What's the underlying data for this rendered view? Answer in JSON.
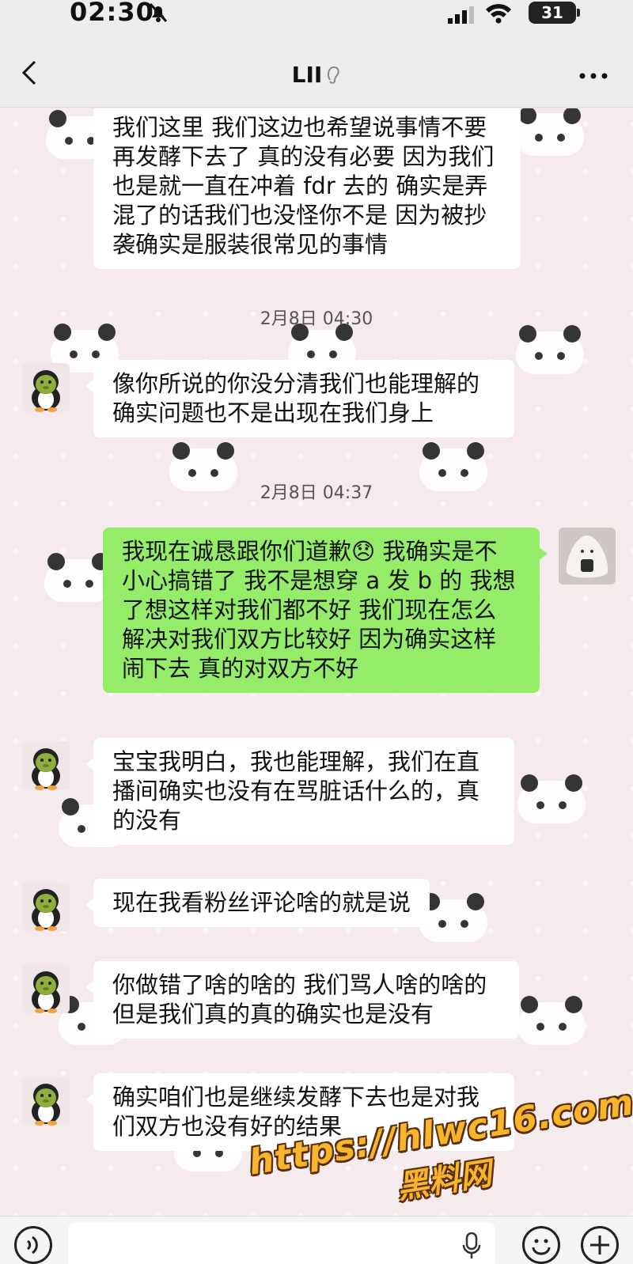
{
  "status": {
    "time": "02:30",
    "battery": "31"
  },
  "nav": {
    "title": "LII"
  },
  "messages": {
    "m1": "我们这里 我们这边也希望说事情不要\n再发酵下去了 真的没有必要 因为我们\n也是就一直在冲着 fdr 去的 确实是弄\n混了的话我们也没怪你不是 因为被抄\n袭确实是服装很常见的事情",
    "ts1": "2月8日 04:30",
    "m2": "像你所说的你没分清我们也能理解的\n确实问题也不是出现在我们身上",
    "ts2": "2月8日 04:37",
    "m3": "我现在诚恳跟你们道歉😞 我确实是不\n小心搞错了  我不是想穿 a 发 b 的 我想\n了想这样对我们都不好  我们现在怎么\n解决对我们双方比较好 因为确实这样\n闹下去 真的对双方不好",
    "m4": "宝宝我明白，我也能理解，我们在直\n播间确实也没有在骂脏话什么的，真\n的没有",
    "m5": "现在我看粉丝评论啥的就是说",
    "m6": "你做错了啥的啥的 我们骂人啥的啥的\n但是我们真的真的确实也是没有",
    "m7": "确实咱们也是继续发酵下去也是对我\n们双方也没有好的结果"
  },
  "watermark": {
    "url": "https://hlwc16.com",
    "name": "黑料网"
  },
  "icons": {
    "back": "chevron-left-icon",
    "more": "more-icon",
    "ear": "ear-icon",
    "voice": "voice-icon",
    "emoji": "emoji-icon",
    "plus": "plus-icon",
    "mic": "mic-icon"
  },
  "colors": {
    "mine_bubble": "#95ec69",
    "theirs_bubble": "#ffffff",
    "bar_bg": "#ededed",
    "watermark": "#f7b52c"
  }
}
